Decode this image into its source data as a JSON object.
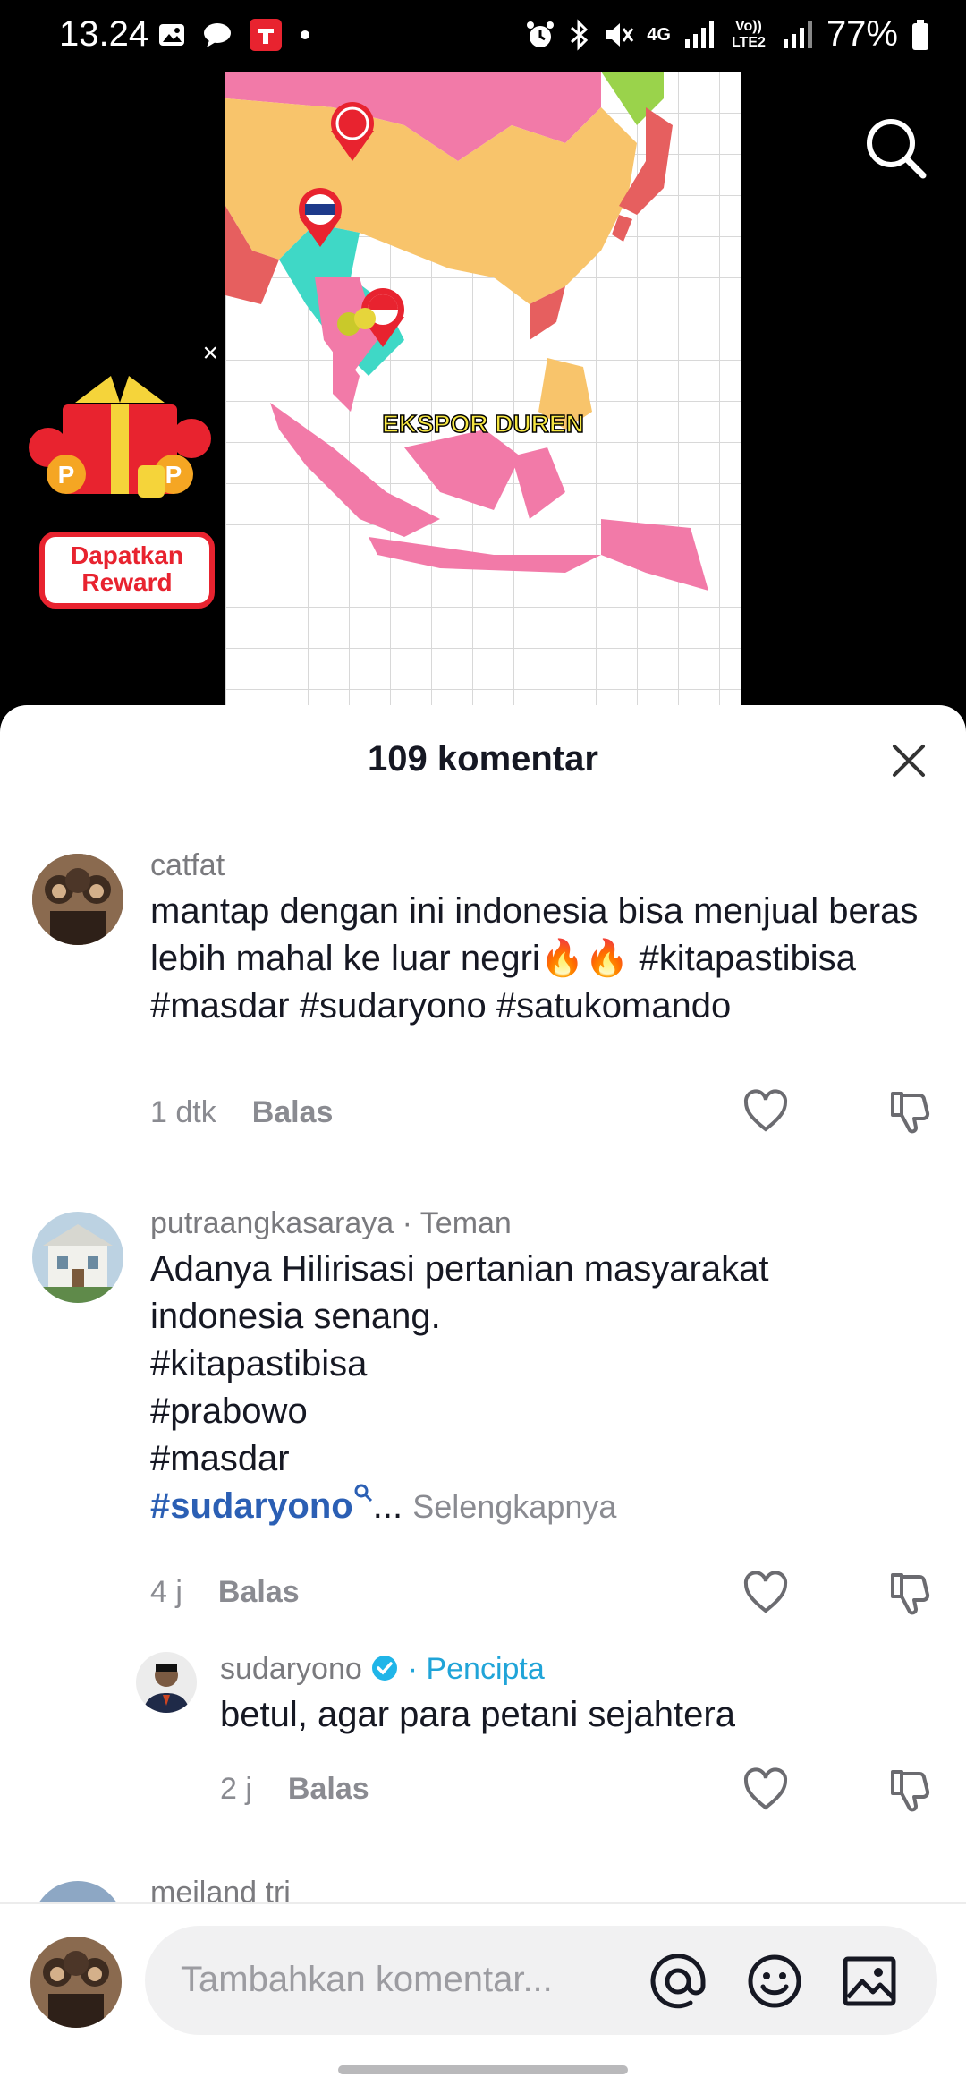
{
  "status_bar": {
    "time": "13.24",
    "battery": "77%",
    "network": "4G",
    "volte": "Vo)) LTE2"
  },
  "video": {
    "caption": "EKSPOR DUREN",
    "reward": {
      "label_line1": "Dapatkan",
      "label_line2": "Reward"
    }
  },
  "comments_sheet": {
    "title": "109 komentar",
    "comments": [
      {
        "username": "catfat",
        "text": "mantap dengan ini indonesia bisa menjual beras lebih mahal ke luar negri🔥🔥 #kitapastibisa #masdar #sudaryono #satukomando",
        "time": "1 dtk",
        "reply_label": "Balas"
      },
      {
        "username": "putraangkasaraya · Teman",
        "text_lines": [
          "Adanya Hilirisasi pertanian masyarakat",
          "indonesia senang.",
          "#kitapastibisa",
          "#prabowo",
          "#masdar"
        ],
        "hashtag_prefix": "#",
        "hashtag_link": "sudaryono",
        "ellipsis": "...",
        "more_label": "Selengkapnya",
        "time": "4 j",
        "reply_label": "Balas"
      },
      {
        "username": "sudaryono",
        "badge_label": "· Pencipta",
        "text": "betul, agar para petani sejahtera",
        "time": "2 j",
        "reply_label": "Balas"
      },
      {
        "username": "meiland tri"
      }
    ]
  },
  "input": {
    "placeholder": "Tambahkan komentar..."
  }
}
